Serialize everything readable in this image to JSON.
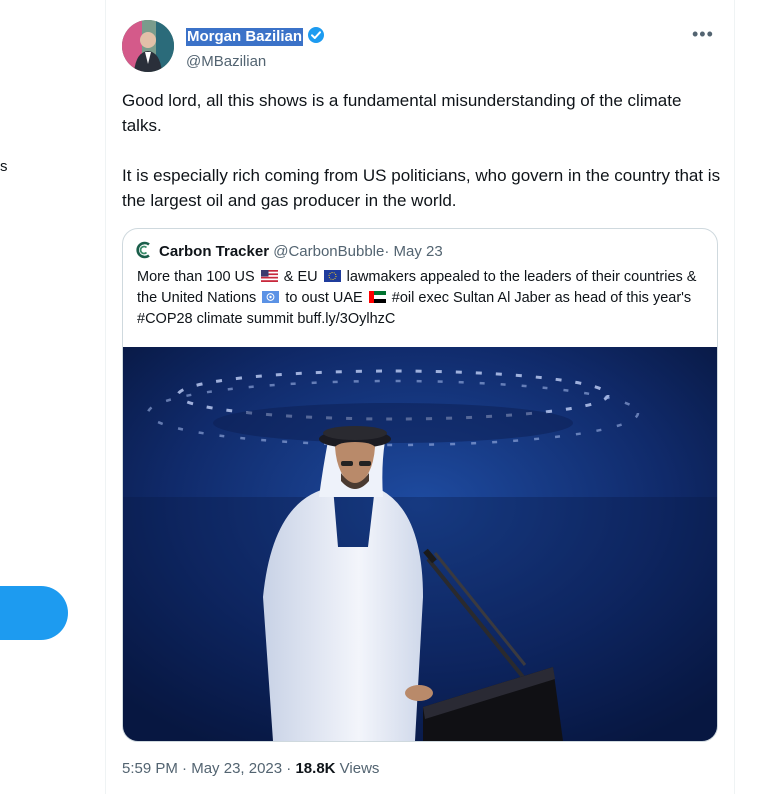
{
  "sidebar": {
    "fragment_text": "s"
  },
  "tweet": {
    "author_name": "Morgan Bazilian",
    "author_handle": "@MBazilian",
    "paragraphs": [
      "Good lord, all this shows is a fundamental misunderstanding of the climate talks.",
      "It is especially rich coming from US politicians, who govern in the country that is the largest oil and gas producer in the world."
    ],
    "time": "5:59 PM",
    "separator": "·",
    "date": "May 23, 2023",
    "views_count": "18.8K",
    "views_label": "Views"
  },
  "quote": {
    "name": "Carbon Tracker",
    "handle": "@CarbonBubble",
    "separator": "·",
    "date": "May 23",
    "text_parts": [
      "More than 100 US",
      "& EU",
      "lawmakers appealed to the leaders of their countries & the United Nations",
      "to oust UAE",
      "#oil exec Sultan Al Jaber as head of this year's #COP28 climate summit buff.ly/3OylhzC"
    ]
  },
  "colors": {
    "accent": "#1d9bf0",
    "text": "#0f1419",
    "muted": "#536471",
    "border": "#cfd9de",
    "selection": "#3b72c8"
  },
  "icons": [
    "verified-badge-icon",
    "more-icon",
    "carbon-tracker-logo-icon",
    "us-flag-icon",
    "eu-flag-icon",
    "un-flag-icon",
    "uae-flag-icon"
  ]
}
